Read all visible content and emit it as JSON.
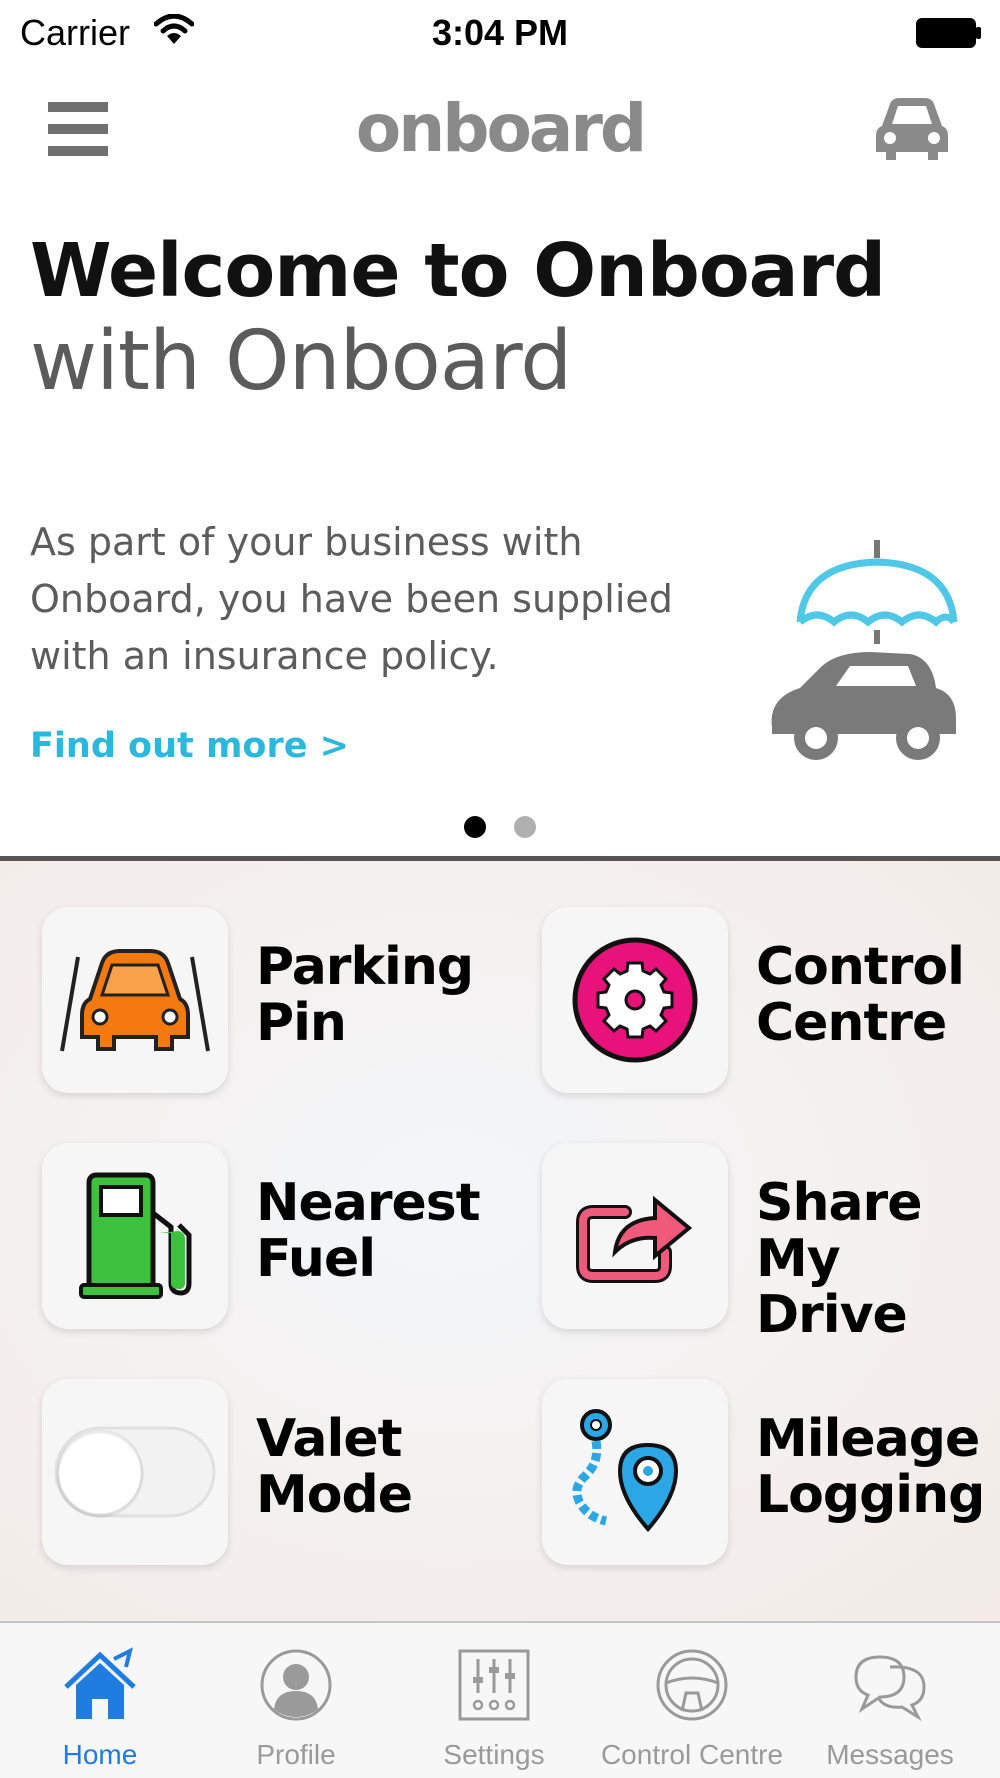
{
  "status_bar": {
    "carrier": "Carrier",
    "time": "3:04 PM"
  },
  "nav": {
    "logo": "onboard"
  },
  "banner": {
    "title": "Welcome to Onboard",
    "subtitle": "with Onboard",
    "body": "As part of your business with Onboard, you have been supplied with an insurance policy.",
    "link": "Find out more >",
    "page_count": 2,
    "active_page": 1
  },
  "tiles": [
    {
      "label": "Parking\nPin",
      "icon": "parking-pin-icon"
    },
    {
      "label": "Control\nCentre",
      "icon": "control-centre-icon"
    },
    {
      "label": "Nearest\nFuel",
      "icon": "fuel-pump-icon"
    },
    {
      "label": "Share\nMy Drive",
      "icon": "share-icon"
    },
    {
      "label": "Valet\nMode",
      "icon": "toggle-switch-icon"
    },
    {
      "label": "Mileage\nLogging",
      "icon": "map-pin-route-icon"
    }
  ],
  "tab_bar": {
    "items": [
      {
        "label": "Home",
        "icon": "home-icon",
        "active": true
      },
      {
        "label": "Profile",
        "icon": "profile-icon",
        "active": false
      },
      {
        "label": "Settings",
        "icon": "settings-sliders-icon",
        "active": false
      },
      {
        "label": "Control Centre",
        "icon": "steering-wheel-icon",
        "active": false
      },
      {
        "label": "Messages",
        "icon": "messages-icon",
        "active": false
      }
    ]
  },
  "colors": {
    "accent_blue": "#1f7ce0",
    "link_cyan": "#2bb8df",
    "control_pink": "#e8127a",
    "fuel_green": "#3cc23c",
    "parking_orange": "#f47a10"
  }
}
